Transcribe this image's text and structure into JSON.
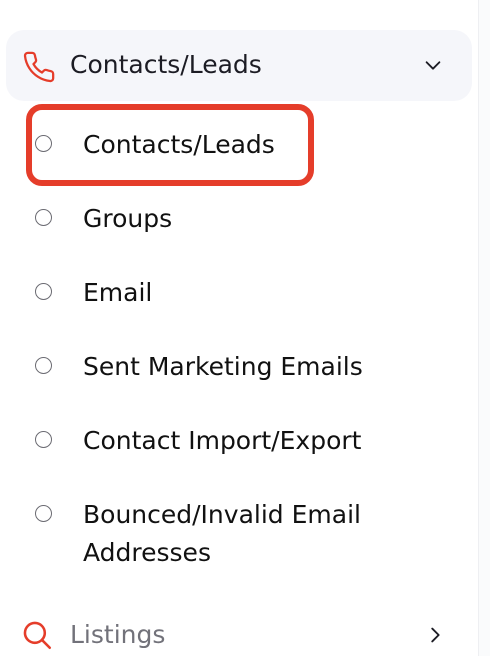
{
  "menu": {
    "group_label": "Contacts/Leads",
    "group_icon": "phone-icon",
    "accent_color": "#e53d2a",
    "items": [
      {
        "label": "Contacts/Leads",
        "selected": true
      },
      {
        "label": "Groups"
      },
      {
        "label": "Email"
      },
      {
        "label": "Sent Marketing Emails"
      },
      {
        "label": "Contact Import/Export"
      },
      {
        "label": "Bounced/Invalid Email"
      },
      {
        "label": "Addresses"
      }
    ],
    "next_group_label": "Listings",
    "next_group_icon": "search-icon"
  }
}
